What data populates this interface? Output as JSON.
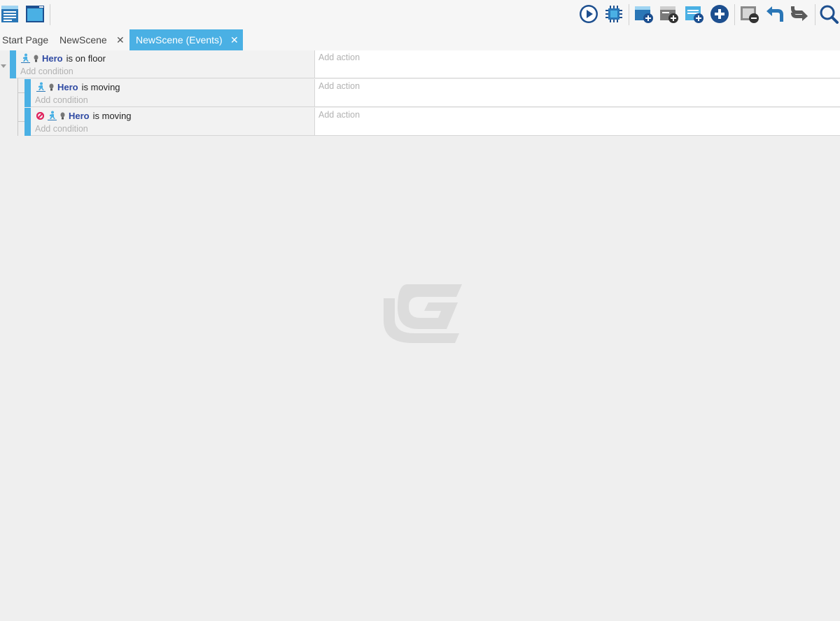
{
  "toolbar": {
    "left_icons": [
      "event-sheet-list-icon",
      "scene-editor-icon"
    ],
    "right_icons": [
      "play-preview-icon",
      "debugger-chip-icon",
      "add-event-icon",
      "add-sub-event-icon",
      "add-comment-icon",
      "add-other-icon",
      "delete-event-icon",
      "undo-icon",
      "redo-icon",
      "search-icon"
    ]
  },
  "tabs": [
    {
      "label": "Start Page",
      "closable": false,
      "active": false
    },
    {
      "label": "NewScene",
      "closable": true,
      "active": false
    },
    {
      "label": "NewScene (Events)",
      "closable": true,
      "active": true
    }
  ],
  "events": [
    {
      "level": 0,
      "condition": {
        "object": "Hero",
        "text": "is on floor",
        "icons": [
          "platformer-character-icon",
          "behavior-bulb-icon"
        ]
      },
      "add_condition": "Add condition",
      "add_action": "Add action"
    },
    {
      "level": 1,
      "condition": {
        "object": "Hero",
        "text": "is moving",
        "icons": [
          "platformer-character-icon",
          "behavior-bulb-icon"
        ]
      },
      "add_condition": "Add condition",
      "add_action": "Add action"
    },
    {
      "level": 1,
      "condition": {
        "object": "Hero",
        "text": "is moving",
        "icons": [
          "invert-condition-icon",
          "platformer-character-icon",
          "behavior-bulb-icon"
        ]
      },
      "add_condition": "Add condition",
      "add_action": "Add action"
    }
  ],
  "colors": {
    "accent": "#4ab0e4",
    "object_name": "#2f4aa3",
    "placeholder": "#b2b2b2",
    "background": "#efefef"
  },
  "watermark_icon": "gdevelop-logo"
}
